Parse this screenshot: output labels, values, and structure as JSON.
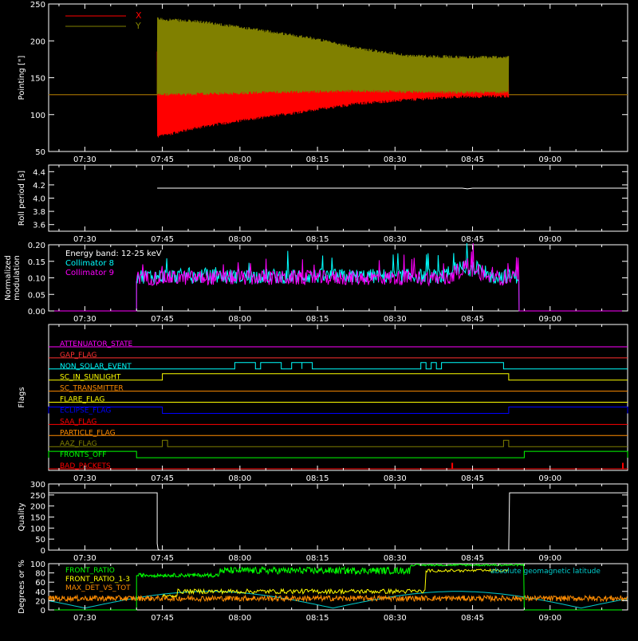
{
  "time_axis": {
    "start": "07:23",
    "end": "09:15",
    "tick_labels": [
      "07:30",
      "07:45",
      "08:00",
      "08:15",
      "08:30",
      "08:45",
      "09:00"
    ],
    "tick_minutes_after_0700": [
      30,
      45,
      60,
      75,
      90,
      105,
      120
    ]
  },
  "colors": {
    "background": "#000000",
    "axes": "#ffffff",
    "x": "#ff0000",
    "y": "#808000",
    "collimator8": "#00ffff",
    "collimator9": "#ff00ff",
    "front_ratio": "#00ff00",
    "front_ratio_aux": "#ffff00",
    "max_det": "#ff8c00",
    "latitude": "#00cccc"
  },
  "chart_data": [
    {
      "type": "line",
      "id": "pointing",
      "ylabel": "Pointing [\"]",
      "ylim": [
        50,
        250
      ],
      "yticks": [
        "50",
        "100",
        "150",
        "200",
        "250"
      ],
      "legend": "top-left",
      "series": [
        {
          "name": "X",
          "color": "#ff0000",
          "start": "07:44",
          "end": "08:52",
          "envelope_low": [
            70,
            85,
            95,
            105,
            115,
            120,
            124,
            125
          ],
          "envelope_high": [
            185,
            180,
            176,
            175,
            175,
            175,
            175,
            175
          ],
          "baseline": 127
        },
        {
          "name": "Y",
          "color": "#808000",
          "start": "07:44",
          "end": "08:52",
          "envelope_low": [
            127,
            128,
            130,
            131,
            132,
            131,
            130,
            130
          ],
          "envelope_high": [
            230,
            225,
            215,
            205,
            190,
            180,
            178,
            178
          ],
          "baseline": 127
        }
      ]
    },
    {
      "type": "line",
      "id": "roll",
      "ylabel": "Roll period [s]",
      "ylim": [
        3.5,
        4.5
      ],
      "yticks": [
        "3.6",
        "3.8",
        "4.0",
        "4.2",
        "4.4"
      ],
      "series": [
        {
          "name": "",
          "color": "#ffffff",
          "constant": 4.15,
          "start": "07:44",
          "end": "09:15"
        }
      ]
    },
    {
      "type": "line",
      "id": "modulation",
      "ylabel": "Normalized modulation",
      "ylim": [
        0,
        0.2
      ],
      "yticks": [
        "0.00",
        "0.05",
        "0.10",
        "0.15",
        "0.20"
      ],
      "legend": "top-left",
      "annotation": "Energy band: 12-25 keV",
      "series": [
        {
          "name": "Collimator 8",
          "color": "#00ffff",
          "start": "07:40",
          "end": "08:54",
          "mean": 0.105
        },
        {
          "name": "Collimator 9",
          "color": "#ff00ff",
          "start": "07:40",
          "end": "08:54",
          "mean": 0.1
        }
      ]
    },
    {
      "type": "line",
      "id": "flags",
      "ylabel": "Flags",
      "flags": [
        {
          "name": "ATTENUATOR_STATE",
          "color": "#ff00ff",
          "transitions": []
        },
        {
          "name": "GAP_FLAG",
          "color": "#ff3030",
          "transitions": []
        },
        {
          "name": "NON_SOLAR_EVENT",
          "color": "#00ffff",
          "transitions": [
            [
              "07:59",
              "08:03"
            ],
            [
              "08:04",
              "08:08"
            ],
            [
              "08:10",
              "08:12"
            ],
            [
              "08:12",
              "08:14"
            ],
            [
              "08:35",
              "08:36"
            ],
            [
              "08:37",
              "08:38"
            ],
            [
              "08:39",
              "08:51"
            ]
          ]
        },
        {
          "name": "SC_IN_SUNLIGHT",
          "color": "#ffff00",
          "transitions": [
            [
              "07:45",
              "08:52"
            ]
          ]
        },
        {
          "name": "SC_TRANSMITTER",
          "color": "#ff8c00",
          "transitions": []
        },
        {
          "name": "FLARE_FLAG",
          "color": "#ffff00",
          "transitions": []
        },
        {
          "name": "ECLIPSE_FLAG",
          "color": "#0000ff",
          "transitions": [
            [
              "07:23",
              "07:45"
            ],
            [
              "08:52",
              "09:15"
            ]
          ]
        },
        {
          "name": "SAA_FLAG",
          "color": "#ff0000",
          "transitions": []
        },
        {
          "name": "PARTICLE_FLAG",
          "color": "#ff8c00",
          "transitions": []
        },
        {
          "name": "AAZ_FLAG",
          "color": "#808000",
          "transitions": [
            [
              "07:45",
              "07:46"
            ],
            [
              "08:51",
              "08:52"
            ]
          ]
        },
        {
          "name": "FRONTS_OFF",
          "color": "#00ff00",
          "transitions": [
            [
              "07:23",
              "07:40"
            ],
            [
              "08:55",
              "09:15"
            ]
          ]
        },
        {
          "name": "BAD_PACKETS",
          "color": "#ff0000",
          "transitions": [
            [
              "08:41",
              "08:41"
            ],
            [
              "09:14",
              "09:14"
            ]
          ]
        }
      ]
    },
    {
      "type": "line",
      "id": "quality",
      "ylabel": "Quality",
      "ylim": [
        0,
        300
      ],
      "yticks": [
        "0",
        "50",
        "100",
        "150",
        "200",
        "250",
        "300"
      ],
      "series": [
        {
          "name": "",
          "color": "#ffffff",
          "high_before": "07:44",
          "high_after": "08:52",
          "high_value": 260
        }
      ]
    },
    {
      "type": "line",
      "id": "ratios",
      "ylabel": "Degrees or %",
      "ylim": [
        0,
        100
      ],
      "yticks": [
        "0",
        "20",
        "40",
        "60",
        "80",
        "100"
      ],
      "legend": "top-left",
      "series": [
        {
          "name": "FRONT_RATIO",
          "color": "#00ff00",
          "start": "07:40",
          "end": "08:55",
          "mean": 85
        },
        {
          "name": "FRONT_RATIO_1-3",
          "color": "#ffff00",
          "start": "07:45",
          "end": "08:52",
          "mean": 45
        },
        {
          "name": "MAX_DET_VS_TOT",
          "color": "#ff8c00",
          "start": "07:23",
          "end": "09:15",
          "mean": 25
        },
        {
          "name": "absolute geomagnetic latitude",
          "color": "#00cccc",
          "start": "07:23",
          "end": "09:15"
        }
      ]
    }
  ]
}
